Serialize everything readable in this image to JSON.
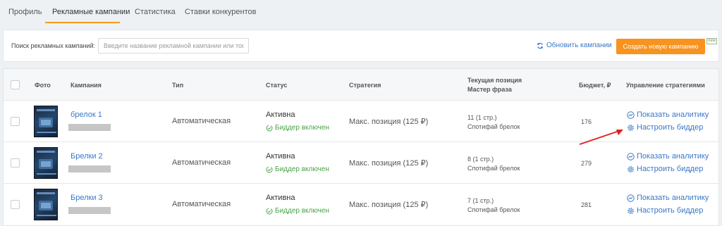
{
  "tabs": [
    {
      "label": "Профиль"
    },
    {
      "label": "Рекламные кампании",
      "active": true
    },
    {
      "label": "Статистика"
    },
    {
      "label": "Ставки конкурентов"
    }
  ],
  "search": {
    "label": "Поиск рекламных кампаний:",
    "placeholder": "Введите название рекламной кампании или товар"
  },
  "toolbar": {
    "refresh_label": "Обновить кампании",
    "create_label": "Создать новую кампанию",
    "new_badge": "new"
  },
  "table": {
    "headers": {
      "photo": "Фото",
      "campaign": "Кампания",
      "type": "Тип",
      "status": "Статус",
      "strategy": "Стратегия",
      "position_line1": "Текущая позиция",
      "position_line2": "Мастер фраза",
      "budget": "Бюджет, ₽",
      "management": "Управление стратегиями"
    },
    "rows": [
      {
        "name": "брелок 1",
        "type": "Автоматическая",
        "status": "Активна",
        "bidder": "Биддер включен",
        "strategy": "Макс. позиция (125 ₽)",
        "position": "11 (1 стр.)",
        "phrase": "Спотифай брелок",
        "budget": "176",
        "analytics": "Показать аналитику",
        "configure": "Настроить биддер"
      },
      {
        "name": "Брелки 2",
        "type": "Автоматическая",
        "status": "Активна",
        "bidder": "Биддер включен",
        "strategy": "Макс. позиция (125 ₽)",
        "position": "8 (1 стр.)",
        "phrase": "Спотифай брелок",
        "budget": "279",
        "analytics": "Показать аналитику",
        "configure": "Настроить биддер"
      },
      {
        "name": "Брелки 3",
        "type": "Автоматическая",
        "status": "Активна",
        "bidder": "Биддер включен",
        "strategy": "Макс. позиция (125 ₽)",
        "position": "7 (1 стр.)",
        "phrase": "Спотифай брелок",
        "budget": "281",
        "analytics": "Показать аналитику",
        "configure": "Настроить биддер"
      }
    ]
  },
  "colors": {
    "accent": "#f7931e",
    "link": "#3a78c8",
    "success": "#4aa347",
    "annotation_arrow": "#e02020"
  },
  "icons": {
    "refresh": "refresh-icon",
    "bidder": "cycle-check-icon",
    "analytics": "analytics-icon",
    "settings": "gear-icon",
    "arrow": "red-arrow-annotation"
  }
}
